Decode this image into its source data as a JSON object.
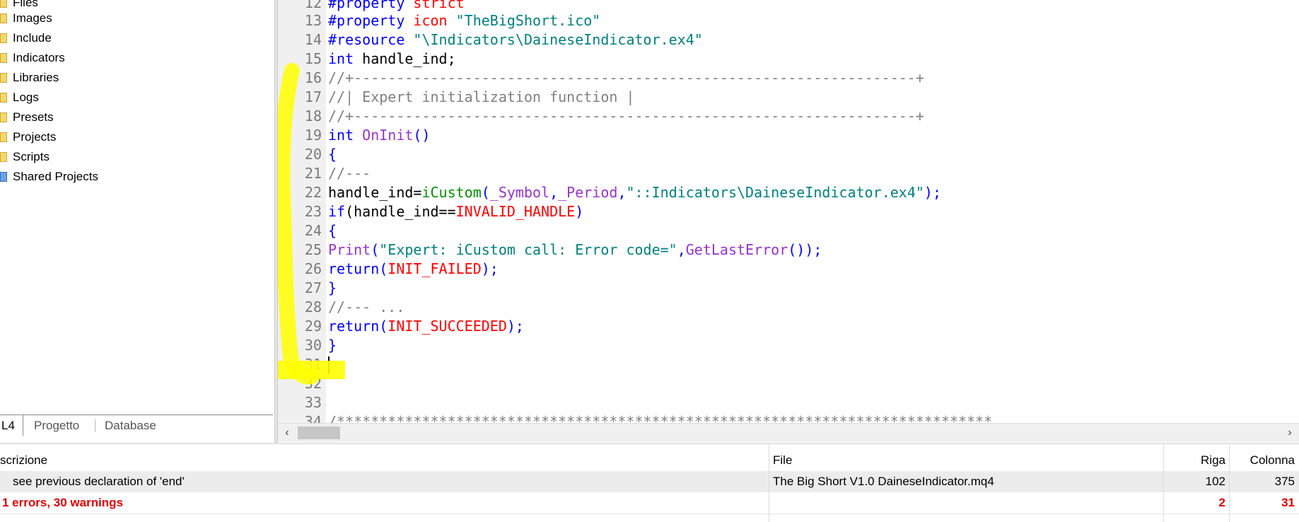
{
  "navigator": {
    "items": [
      {
        "label": "Files",
        "icon": "folder-icon"
      },
      {
        "label": "Images",
        "icon": "folder-icon"
      },
      {
        "label": "Include",
        "icon": "folder-icon"
      },
      {
        "label": "Indicators",
        "icon": "folder-icon"
      },
      {
        "label": "Libraries",
        "icon": "folder-icon"
      },
      {
        "label": "Logs",
        "icon": "folder-icon"
      },
      {
        "label": "Presets",
        "icon": "folder-icon"
      },
      {
        "label": "Projects",
        "icon": "folder-icon"
      },
      {
        "label": "Scripts",
        "icon": "folder-icon"
      },
      {
        "label": "Shared Projects",
        "icon": "shared-projects-icon"
      }
    ],
    "tabs": [
      {
        "label": "L4"
      },
      {
        "label": "Progetto"
      },
      {
        "label": "Database"
      }
    ]
  },
  "editor": {
    "line_numbers": [
      "12",
      "13",
      "14",
      "15",
      "16",
      "17",
      "18",
      "19",
      "20",
      "21",
      "22",
      "23",
      "24",
      "25",
      "26",
      "27",
      "28",
      "29",
      "30",
      "31",
      "32",
      "33",
      "34"
    ],
    "lines": {
      "l12": {
        "a": "#property",
        "b": " strict"
      },
      "l13": {
        "a": "#property",
        "b": " icon ",
        "c": "\"TheBigShort.ico\""
      },
      "l14": {
        "a": "#resource",
        "b": " \"\\Indicators\\DaineseIndicator.ex4\""
      },
      "l15": {
        "a": "int",
        "b": " handle_ind;"
      },
      "l16": {
        "a": "//+------------------------------------------------------------------+"
      },
      "l17": {
        "a": "//| Expert initialization function |"
      },
      "l18": {
        "a": "//+------------------------------------------------------------------+"
      },
      "l19": {
        "a": "int",
        "b": " ",
        "c": "OnInit",
        "d": "()"
      },
      "l20": {
        "a": "{"
      },
      "l21": {
        "a": "//---"
      },
      "l22": {
        "a": "handle_ind=",
        "b": "iCustom",
        "c": "(",
        "d": "_Symbol",
        "e": ",",
        "f": "_Period",
        "g": ",",
        "h": "\"::Indicators\\DaineseIndicator.ex4\"",
        "i": ");"
      },
      "l23": {
        "a": "if",
        "b": "(handle_ind==",
        "c": "INVALID_HANDLE",
        "d": ")"
      },
      "l24": {
        "a": "{"
      },
      "l25": {
        "a": "Print",
        "b": "(",
        "c": "\"Expert: iCustom call: Error code=\"",
        "d": ",",
        "e": "GetLastError",
        "f": "());"
      },
      "l26": {
        "a": "return",
        "b": "(",
        "c": "INIT_FAILED",
        "d": ");"
      },
      "l27": {
        "a": "}"
      },
      "l28": {
        "a": "//--- ..."
      },
      "l29": {
        "a": "return",
        "b": "(",
        "c": "INIT_SUCCEEDED",
        "d": ");"
      },
      "l30": {
        "a": "}"
      },
      "l34": {
        "a": "/*****************************************************************************"
      }
    }
  },
  "errors": {
    "headers": {
      "description": "scrizione",
      "file": "File",
      "line": "Riga",
      "column": "Colonna"
    },
    "rows": [
      {
        "description": "see previous declaration of 'end'",
        "file": "The Big Short V1.0 DaineseIndicator.mq4",
        "line": "102",
        "column": "375"
      }
    ],
    "summary": {
      "description": "1 errors, 30 warnings",
      "line": "2",
      "column": "31"
    }
  },
  "colors": {
    "highlight": "#ffff00",
    "keyword": "#0000ff",
    "string": "#008080",
    "comment": "#808080",
    "constant": "#ff0000",
    "function": "#9932cc",
    "error_text": "#e00000"
  }
}
